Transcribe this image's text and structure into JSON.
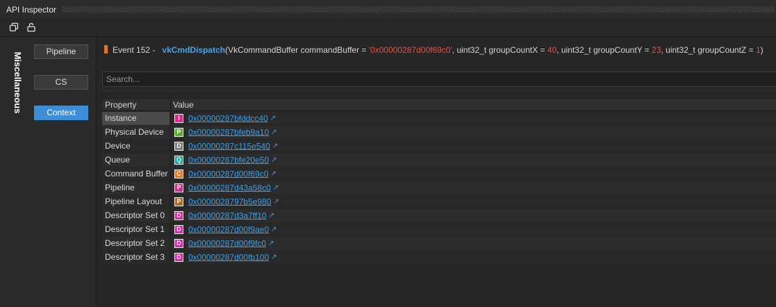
{
  "window": {
    "title": "API Inspector"
  },
  "toolbar": {
    "icons": [
      "copy-icon",
      "lock-icon"
    ]
  },
  "sidebar": {
    "vertical_tab": "Miscellaneous",
    "buttons": [
      {
        "label": "Pipeline",
        "active": false
      },
      {
        "label": "CS",
        "active": false
      },
      {
        "label": "Context",
        "active": true
      }
    ]
  },
  "event": {
    "prefix": "Event 152 -",
    "function": "vkCmdDispatch",
    "args_open": "(VkCommandBuffer commandBuffer = ",
    "cmd_buffer_value": "'0x00000287d00f69c0'",
    "sep1": ", uint32_t groupCountX = ",
    "group_x": "40",
    "sep2": ", uint32_t groupCountY = ",
    "group_y": "23",
    "sep3": ", uint32_t groupCountZ = ",
    "group_z": "1",
    "args_close": ")"
  },
  "search": {
    "placeholder": "Search..."
  },
  "table": {
    "headers": {
      "property": "Property",
      "value": "Value"
    },
    "rows": [
      {
        "property": "Instance",
        "badge": "I",
        "badge_color": "#e0268a",
        "value": "0x00000287bfddcc40",
        "selected": true
      },
      {
        "property": "Physical Device",
        "badge": "P",
        "badge_color": "#5fa832",
        "value": "0x00000287bfeb9a10"
      },
      {
        "property": "Device",
        "badge": "D",
        "badge_color": "#7a7a7a",
        "value": "0x00000287c115e540"
      },
      {
        "property": "Queue",
        "badge": "Q",
        "badge_color": "#18a39a",
        "value": "0x00000287bfe20e50"
      },
      {
        "property": "Command Buffer",
        "badge": "C",
        "badge_color": "#e0782a",
        "value": "0x00000287d00f69c0"
      },
      {
        "property": "Pipeline",
        "badge": "P",
        "badge_color": "#c8328e",
        "value": "0x00000287d43a58c0"
      },
      {
        "property": "Pipeline Layout",
        "badge": "P",
        "badge_color": "#a8682a",
        "value": "0x0000028797b5e980"
      },
      {
        "property": "Descriptor Set 0",
        "badge": "D",
        "badge_color": "#d02aa4",
        "value": "0x00000287d3a7ff10"
      },
      {
        "property": "Descriptor Set 1",
        "badge": "D",
        "badge_color": "#d02aa4",
        "value": "0x00000287d00f9ae0"
      },
      {
        "property": "Descriptor Set 2",
        "badge": "D",
        "badge_color": "#d02aa4",
        "value": "0x00000287d00f9fc0"
      },
      {
        "property": "Descriptor Set 3",
        "badge": "D",
        "badge_color": "#d02aa4",
        "value": "0x00000287d00fb100"
      }
    ]
  }
}
